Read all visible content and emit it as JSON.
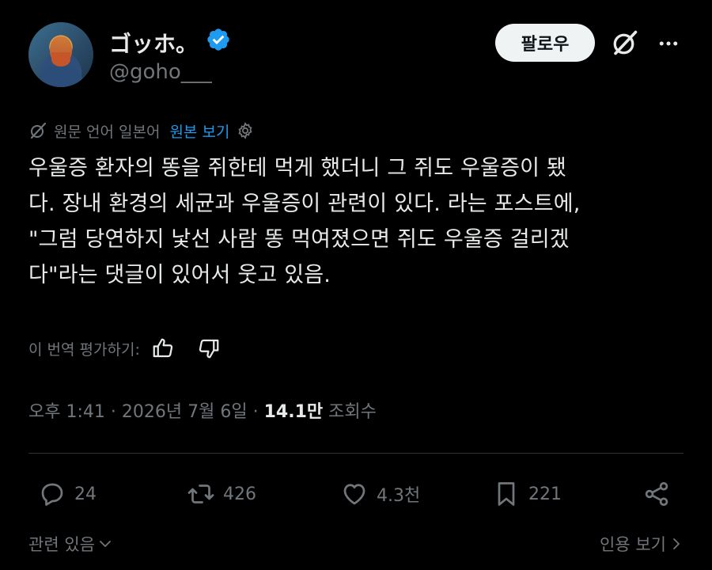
{
  "author": {
    "display_name": "ゴッホ。",
    "handle": "@goho___"
  },
  "follow_label": "팔로우",
  "translation": {
    "original_language": "원문 언어 일본어",
    "view_original": "원본 보기"
  },
  "tweet": {
    "text": "우울증 환자의 똥을 쥐한테 먹게 했더니 그 쥐도 우울증이 됐\n다. 장내 환경의 세균과 우울증이 관련이 있다. 라는 포스트에,\n\"그럼 당연하지 낯선 사람 똥 먹여졌으면 쥐도 우울증 걸리겠\n다\"라는 댓글이 있어서 웃고 있음."
  },
  "rate_translation": "이 번역 평가하기:",
  "meta": {
    "time": "오후 1:41",
    "date": "2026년 7월 6일",
    "views_count": "14.1만",
    "views_label": "조회수",
    "separator": "·"
  },
  "actions": {
    "replies": "24",
    "reposts": "426",
    "likes": "4.3천",
    "bookmarks": "221"
  },
  "footer": {
    "related": "관련 있음",
    "view_quotes": "인용 보기"
  },
  "colors": {
    "background": "#000000",
    "text": "#e7e9ea",
    "secondary": "#71767b",
    "accent": "#1d9bf0"
  }
}
